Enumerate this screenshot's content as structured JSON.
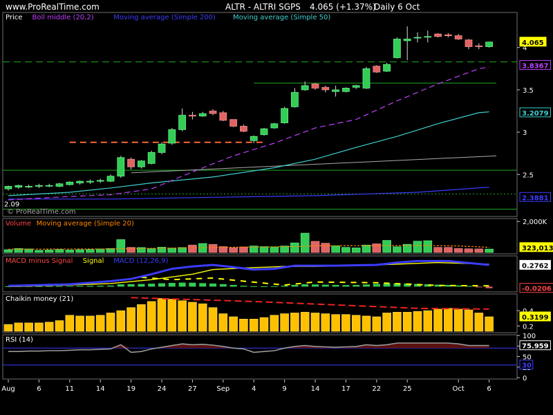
{
  "site": "www.ProRealTime.com",
  "header": {
    "symbol": "ALTR - ALTRI SGPS",
    "last": "4.065 (+1.37%)",
    "period": "Daily  6 Oct"
  },
  "watermark": "© ProRealTime.com",
  "x_axis": {
    "labels": [
      {
        "text": "Aug",
        "i": 0
      },
      {
        "text": "6",
        "i": 3
      },
      {
        "text": "11",
        "i": 6
      },
      {
        "text": "14",
        "i": 9
      },
      {
        "text": "19",
        "i": 12
      },
      {
        "text": "24",
        "i": 15
      },
      {
        "text": "27",
        "i": 18
      },
      {
        "text": "Sep",
        "i": 21
      },
      {
        "text": "4",
        "i": 24
      },
      {
        "text": "9",
        "i": 27
      },
      {
        "text": "14",
        "i": 30
      },
      {
        "text": "17",
        "i": 33
      },
      {
        "text": "22",
        "i": 36
      },
      {
        "text": "25",
        "i": 39
      },
      {
        "text": "Oct",
        "i": 44
      },
      {
        "text": "6",
        "i": 47
      }
    ]
  },
  "chart_data": [
    {
      "type": "candlestick",
      "name": "price",
      "legend": [
        {
          "text": "Price",
          "color": "#ffffff"
        },
        {
          "text": "Boll middle (20,2)",
          "color": "#c040ff"
        },
        {
          "text": "Moving average (Simple 200)",
          "color": "#3c3cff"
        },
        {
          "text": "Moving average (Simple 50)",
          "color": "#40d0d0"
        }
      ],
      "ylim": [
        2.02,
        4.3
      ],
      "y_ticks": [
        2.5,
        3,
        3.5,
        4
      ],
      "y_tick_labels": [
        "2.5",
        "3",
        "3.5",
        "4"
      ],
      "low_label": "2.09",
      "ohlc": [
        [
          2.33,
          2.37,
          2.31,
          2.36
        ],
        [
          2.35,
          2.38,
          2.33,
          2.37
        ],
        [
          2.36,
          2.38,
          2.34,
          2.36
        ],
        [
          2.36,
          2.39,
          2.34,
          2.37
        ],
        [
          2.37,
          2.39,
          2.35,
          2.37
        ],
        [
          2.36,
          2.4,
          2.35,
          2.39
        ],
        [
          2.38,
          2.42,
          2.37,
          2.41
        ],
        [
          2.4,
          2.43,
          2.38,
          2.42
        ],
        [
          2.41,
          2.44,
          2.39,
          2.42
        ],
        [
          2.42,
          2.45,
          2.4,
          2.43
        ],
        [
          2.42,
          2.5,
          2.41,
          2.48
        ],
        [
          2.48,
          2.72,
          2.46,
          2.7
        ],
        [
          2.68,
          2.7,
          2.56,
          2.59
        ],
        [
          2.59,
          2.67,
          2.57,
          2.66
        ],
        [
          2.63,
          2.78,
          2.62,
          2.76
        ],
        [
          2.76,
          2.88,
          2.74,
          2.86
        ],
        [
          2.87,
          3.05,
          2.85,
          3.03
        ],
        [
          3.03,
          3.28,
          3.01,
          3.2
        ],
        [
          3.2,
          3.24,
          3.15,
          3.19
        ],
        [
          3.19,
          3.24,
          3.18,
          3.22
        ],
        [
          3.25,
          3.27,
          3.2,
          3.22
        ],
        [
          3.23,
          3.25,
          3.13,
          3.14
        ],
        [
          3.15,
          3.15,
          3.06,
          3.07
        ],
        [
          3.07,
          3.09,
          3.0,
          3.01
        ],
        [
          2.9,
          2.96,
          2.87,
          2.95
        ],
        [
          2.97,
          3.05,
          2.96,
          3.04
        ],
        [
          3.05,
          3.11,
          3.04,
          3.1
        ],
        [
          3.11,
          3.3,
          3.1,
          3.28
        ],
        [
          3.3,
          3.52,
          3.29,
          3.47
        ],
        [
          3.5,
          3.6,
          3.49,
          3.55
        ],
        [
          3.57,
          3.58,
          3.5,
          3.52
        ],
        [
          3.53,
          3.55,
          3.47,
          3.5
        ],
        [
          3.48,
          3.55,
          3.42,
          3.5
        ],
        [
          3.48,
          3.53,
          3.47,
          3.52
        ],
        [
          3.53,
          3.56,
          3.51,
          3.55
        ],
        [
          3.52,
          3.77,
          3.51,
          3.75
        ],
        [
          3.78,
          3.79,
          3.7,
          3.71
        ],
        [
          3.72,
          3.82,
          3.71,
          3.8
        ],
        [
          3.88,
          4.12,
          3.87,
          4.1
        ],
        [
          4.08,
          4.25,
          3.85,
          4.1
        ],
        [
          4.12,
          4.18,
          4.06,
          4.12
        ],
        [
          4.13,
          4.2,
          4.06,
          4.13
        ],
        [
          4.16,
          4.17,
          4.12,
          4.13
        ],
        [
          4.15,
          4.17,
          4.12,
          4.14
        ],
        [
          4.14,
          4.16,
          4.09,
          4.1
        ],
        [
          4.09,
          4.1,
          3.98,
          4.01
        ],
        [
          4.02,
          4.05,
          3.98,
          4.01
        ],
        [
          4.01,
          4.07,
          4.0,
          4.065
        ]
      ],
      "boll_middle": [
        [
          0,
          2.2
        ],
        [
          6,
          2.24
        ],
        [
          10,
          2.26
        ],
        [
          14,
          2.33
        ],
        [
          18,
          2.53
        ],
        [
          22,
          2.72
        ],
        [
          26,
          2.87
        ],
        [
          30,
          3.05
        ],
        [
          34,
          3.15
        ],
        [
          38,
          3.37
        ],
        [
          42,
          3.57
        ],
        [
          46,
          3.75
        ],
        [
          47,
          3.77
        ]
      ],
      "ma200": [
        [
          0,
          2.21
        ],
        [
          10,
          2.21
        ],
        [
          20,
          2.23
        ],
        [
          30,
          2.25
        ],
        [
          40,
          2.29
        ],
        [
          47,
          2.35
        ]
      ],
      "ma50": [
        [
          0,
          2.25
        ],
        [
          6,
          2.29
        ],
        [
          10,
          2.34
        ],
        [
          14,
          2.4
        ],
        [
          20,
          2.47
        ],
        [
          26,
          2.58
        ],
        [
          30,
          2.68
        ],
        [
          34,
          2.82
        ],
        [
          38,
          2.95
        ],
        [
          42,
          3.1
        ],
        [
          46,
          3.23
        ],
        [
          47,
          3.24
        ]
      ],
      "h_lines": [
        {
          "y": 3.83,
          "style": "dash",
          "color": "#22aa22"
        },
        {
          "y": 2.55,
          "style": "solid",
          "color": "#22aa22"
        },
        {
          "y": 2.09,
          "style": "solid",
          "color": "#22aa22"
        },
        {
          "y": 2.27,
          "style": "dot",
          "color": "#22aa22"
        }
      ],
      "seg_resistance": {
        "y": 3.58,
        "from": 24,
        "to": 47.7,
        "color": "#22aa22"
      },
      "seg_support": {
        "y": 2.88,
        "from": 6,
        "to": 25,
        "color": "#ff6633"
      },
      "trend_line": {
        "p1": [
          12,
          2.52
        ],
        "p2": [
          47.7,
          2.72
        ],
        "color": "#aaaaaa"
      },
      "badges": [
        {
          "text": "4.065",
          "y": 4.065,
          "bg": "#ffff00",
          "fg": "#000000",
          "key": "last"
        },
        {
          "text": "3.8367",
          "y": 3.79,
          "bg": "#000000",
          "fg": "#c040ff",
          "key": "boll"
        },
        {
          "text": "3.2079",
          "y": 3.23,
          "bg": "#000000",
          "fg": "#40d0d0",
          "key": "ma50"
        },
        {
          "text": "2.3881",
          "y": 2.23,
          "bg": "#000000",
          "fg": "#3c3cff",
          "key": "ma200"
        }
      ]
    },
    {
      "type": "bar",
      "name": "volume",
      "legend": [
        {
          "text": "Volume",
          "color": "#ff4444"
        },
        {
          "text": "Moving average (Simple 20)",
          "color": "#ff8800"
        }
      ],
      "ylim": [
        0,
        2100000
      ],
      "y_ticks": [
        2000000
      ],
      "y_tick_labels": [
        "2,000K"
      ],
      "values": [
        180000,
        260000,
        230000,
        140000,
        160000,
        200000,
        160000,
        180000,
        200000,
        230000,
        260000,
        830000,
        330000,
        320000,
        250000,
        340000,
        280000,
        320000,
        480000,
        580000,
        520000,
        380000,
        310000,
        360000,
        420000,
        380000,
        360000,
        420000,
        620000,
        1250000,
        720000,
        600000,
        430000,
        330000,
        300000,
        480000,
        560000,
        780000,
        370000,
        530000,
        730000,
        760000,
        330000,
        330000,
        260000,
        240000,
        230000,
        220000
      ],
      "ma20": [
        [
          0,
          210000
        ],
        [
          10,
          230000
        ],
        [
          20,
          320000
        ],
        [
          28,
          380000
        ],
        [
          30,
          430000
        ],
        [
          34,
          440000
        ],
        [
          40,
          450000
        ],
        [
          44,
          420000
        ],
        [
          47,
          330000
        ]
      ],
      "badges": [
        {
          "text": "323,013",
          "value": 323013,
          "bg": "#ffff00",
          "fg": "#000000"
        }
      ]
    },
    {
      "type": "macd",
      "name": "macd",
      "legend": [
        {
          "text": "MACD minus Signal",
          "color": "#ff4444"
        },
        {
          "text": "Signal",
          "color": "#ffff00"
        },
        {
          "text": "MACD (12,26,9)",
          "color": "#3c3cff"
        }
      ],
      "ylim": [
        -0.05,
        0.36
      ],
      "histogram": [
        0.005,
        0.005,
        0.006,
        0.006,
        0.007,
        0.008,
        0.009,
        0.01,
        0.011,
        0.012,
        0.014,
        0.03,
        0.032,
        0.034,
        0.038,
        0.043,
        0.048,
        0.052,
        0.05,
        0.045,
        0.04,
        0.032,
        0.022,
        0.012,
        0.005,
        0.004,
        0.006,
        0.012,
        0.022,
        0.03,
        0.028,
        0.025,
        0.022,
        0.02,
        0.021,
        0.028,
        0.034,
        0.04,
        0.042,
        0.04,
        0.035,
        0.03,
        0.025,
        0.022,
        0.016,
        0.01,
        -0.004,
        -0.02
      ],
      "signal": [
        [
          0,
          0.0
        ],
        [
          6,
          0.02
        ],
        [
          10,
          0.04
        ],
        [
          14,
          0.09
        ],
        [
          18,
          0.16
        ],
        [
          20,
          0.22
        ],
        [
          23,
          0.24
        ],
        [
          27,
          0.26
        ],
        [
          30,
          0.26
        ],
        [
          34,
          0.27
        ],
        [
          38,
          0.29
        ],
        [
          42,
          0.31
        ],
        [
          47,
          0.29
        ]
      ],
      "macd": [
        [
          0,
          0.01
        ],
        [
          6,
          0.03
        ],
        [
          10,
          0.07
        ],
        [
          12,
          0.1
        ],
        [
          14,
          0.16
        ],
        [
          16,
          0.23
        ],
        [
          18,
          0.26
        ],
        [
          20,
          0.28
        ],
        [
          22,
          0.25
        ],
        [
          24,
          0.22
        ],
        [
          26,
          0.23
        ],
        [
          28,
          0.27
        ],
        [
          32,
          0.27
        ],
        [
          36,
          0.28
        ],
        [
          38,
          0.31
        ],
        [
          40,
          0.33
        ],
        [
          43,
          0.33
        ],
        [
          47,
          0.28
        ]
      ],
      "diff_line": [
        [
          13,
          0.12
        ],
        [
          16,
          0.09
        ],
        [
          20,
          0.11
        ],
        [
          23,
          0.07
        ],
        [
          27,
          0.02
        ],
        [
          30,
          0.06
        ],
        [
          36,
          0.05
        ],
        [
          42,
          0.015
        ],
        [
          47,
          0.01
        ]
      ],
      "badges": [
        {
          "text": "0.2762",
          "value": 0.2762,
          "bg": "#ffffff",
          "fg": "#000000"
        },
        {
          "text": "-0.0206",
          "value": -0.0206,
          "bg": "#000000",
          "fg": "#ff4444"
        }
      ]
    },
    {
      "type": "bar",
      "name": "chaikin",
      "legend": [
        {
          "text": "Chaikin money (21)",
          "color": "#ffffff"
        }
      ],
      "ylim": [
        0.13,
        0.6
      ],
      "y_ticks": [
        0.2,
        0.4
      ],
      "y_tick_labels": [
        "0.2",
        "0.4"
      ],
      "values": [
        0.22,
        0.24,
        0.24,
        0.24,
        0.25,
        0.27,
        0.34,
        0.33,
        0.33,
        0.34,
        0.37,
        0.4,
        0.44,
        0.48,
        0.52,
        0.56,
        0.55,
        0.53,
        0.51,
        0.49,
        0.44,
        0.36,
        0.32,
        0.29,
        0.29,
        0.31,
        0.34,
        0.36,
        0.37,
        0.38,
        0.37,
        0.36,
        0.35,
        0.35,
        0.34,
        0.33,
        0.32,
        0.37,
        0.38,
        0.38,
        0.39,
        0.4,
        0.42,
        0.43,
        0.42,
        0.41,
        0.37,
        0.32
      ],
      "trend": [
        [
          12,
          0.57
        ],
        [
          24,
          0.52
        ],
        [
          40,
          0.43
        ],
        [
          47,
          0.42
        ]
      ],
      "badges": [
        {
          "text": "0.3199",
          "value": 0.3199,
          "bg": "#ffff00",
          "fg": "#000000"
        }
      ]
    },
    {
      "type": "line",
      "name": "rsi",
      "legend": [
        {
          "text": "RSI (14)",
          "color": "#ffffff"
        }
      ],
      "ylim": [
        0,
        100
      ],
      "y_ticks": [
        0,
        25,
        50,
        75,
        100
      ],
      "y_tick_labels": [
        "0",
        "25",
        "50",
        "75",
        "100"
      ],
      "levels": [
        30,
        70
      ],
      "values": [
        62,
        62,
        63,
        63,
        64,
        64,
        65,
        66,
        66,
        67,
        68,
        78,
        60,
        62,
        68,
        72,
        76,
        80,
        78,
        79,
        77,
        74,
        70,
        68,
        60,
        62,
        64,
        70,
        74,
        76,
        74,
        73,
        72,
        73,
        74,
        78,
        76,
        78,
        82,
        82,
        82,
        82,
        82,
        82,
        80,
        76,
        76,
        76
      ],
      "badges": [
        {
          "text": "75.959",
          "value": 75.959,
          "bg": "#000000",
          "fg": "#ffffff"
        },
        {
          "text": "30",
          "value": 30,
          "bg": "#000000",
          "fg": "#3c3cff"
        }
      ]
    }
  ]
}
